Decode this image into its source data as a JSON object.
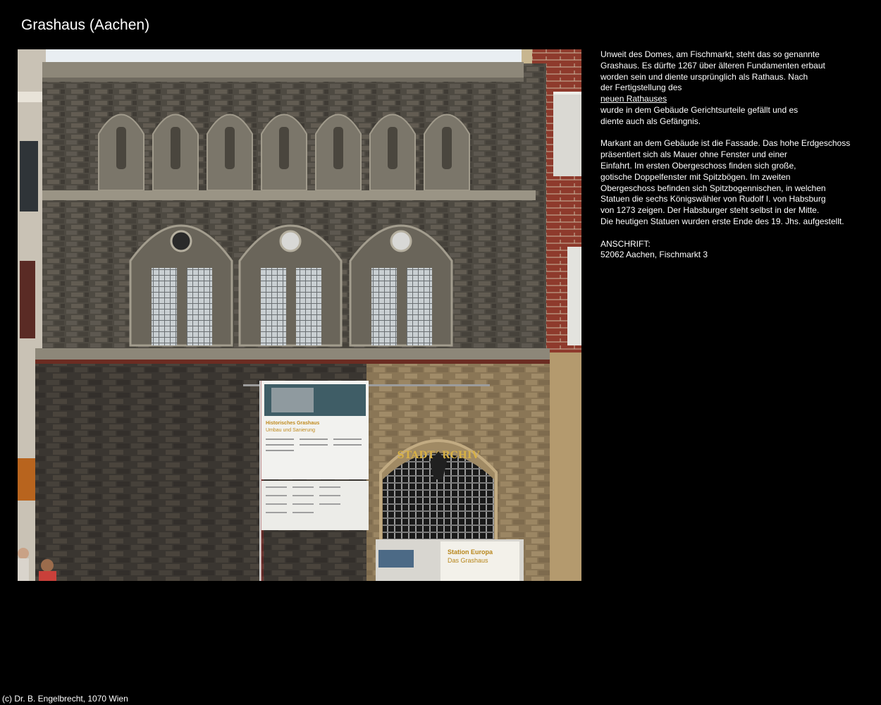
{
  "page": {
    "title": "Grashaus (Aachen)",
    "footer": "(c) Dr. B. Engelbrecht, 1070 Wien"
  },
  "photo": {
    "signs": {
      "main_title": "Historisches Grashaus",
      "main_subtitle": "Umbau und Sanierung",
      "station_title": "Station Europa",
      "station_subtitle": "Das Grashaus",
      "arch_lettering": "STADTARCHIV"
    }
  },
  "description": {
    "p1_before": [
      "Unweit des Domes, am Fischmarkt, steht das so genannte",
      "Grashaus. Es dürfte 1267 über älteren Fundamenten erbaut",
      "worden sein und diente ursprünglich als Rathaus. Nach",
      "der Fertigstellung des"
    ],
    "p1_link": "neuen Rathauses",
    "p1_after": [
      "wurde in dem Gebäude Gerichtsurteile gefällt und es",
      "diente auch als Gefängnis."
    ],
    "p2": [
      "Markant an dem Gebäude ist die Fassade. Das hohe Erdgeschoss",
      "präsentiert sich als Mauer ohne Fenster und einer",
      "Einfahrt. Im ersten Obergeschoss finden sich große,",
      "gotische Doppelfenster mit Spitzbögen. Im zweiten",
      "Obergeschoss befinden sich Spitzbogennischen, in welchen",
      "Statuen die sechs Königswähler von Rudolf I. von Habsburg",
      "von 1273 zeigen. Der Habsburger steht selbst in der Mitte.",
      "Die heutigen Statuen wurden erste Ende des 19. Jhs. aufgestellt."
    ],
    "address_label": "ANSCHRIFT:",
    "address": "52062 Aachen, Fischmarkt 3"
  },
  "colors": {
    "background": "#000000",
    "text": "#ffffff"
  }
}
